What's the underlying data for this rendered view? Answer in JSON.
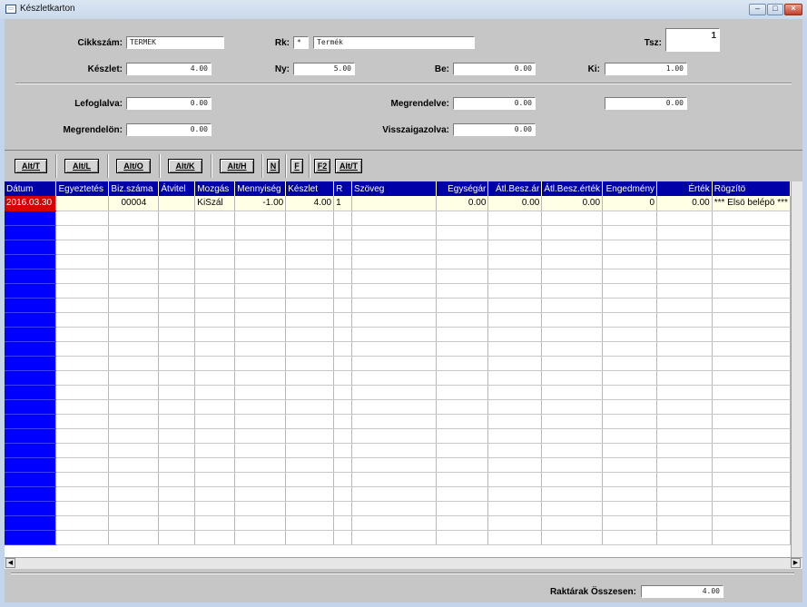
{
  "window": {
    "title": "Készletkarton",
    "minimize": "–",
    "maximize": "□",
    "close": "×"
  },
  "form": {
    "cikkszam_label": "Cikkszám:",
    "cikkszam_value": "TERMEK",
    "rk_label": "Rk:",
    "rk_code": "*",
    "rk_name": "Termék",
    "tsz_label": "Tsz:",
    "tsz_value": "1",
    "keszlet_label": "Készlet:",
    "keszlet_value": "4.00",
    "ny_label": "Ny:",
    "ny_value": "5.00",
    "be_label": "Be:",
    "be_value": "0.00",
    "ki_label": "Ki:",
    "ki_value": "1.00",
    "lefoglalva_label": "Lefoglalva:",
    "lefoglalva_value": "0.00",
    "megrendelve_label": "Megrendelve:",
    "megrendelve_value": "0.00",
    "extra_value": "0.00",
    "megrendelon_label": "Megrendelön:",
    "megrendelon_value": "0.00",
    "visszaigazolva_label": "Visszaigazolva:",
    "visszaigazolva_value": "0.00"
  },
  "toolbar": {
    "b1": "Alt/T",
    "b2": "Alt/L",
    "b3": "Alt/O",
    "b4": "Alt/K",
    "b5": "Alt/H",
    "b6": "N",
    "b7": "F",
    "b8": "F2",
    "b9": "Alt/T"
  },
  "grid": {
    "columns": [
      "Dátum",
      "Egyeztetés",
      "Biz.száma",
      "Átvitel",
      "Mozgás",
      "Mennyiség",
      "Készlet",
      "R",
      "Szöveg",
      "Egységár",
      "Átl.Besz.ár",
      "Átl.Besz.érték",
      "Engedmény",
      "Érték",
      "Rögzítö"
    ],
    "rows": [
      [
        "2016.03.30",
        "",
        "00004",
        "",
        "KiSzál",
        "-1.00",
        "4.00",
        "1",
        "",
        "0.00",
        "0.00",
        "0.00",
        "0",
        "0.00",
        "*** Elsö  belépö ***"
      ]
    ]
  },
  "footer": {
    "total_label": "Raktárak Összesen:",
    "total_value": "4.00"
  },
  "scroll": {
    "left": "◀",
    "right": "▶"
  }
}
